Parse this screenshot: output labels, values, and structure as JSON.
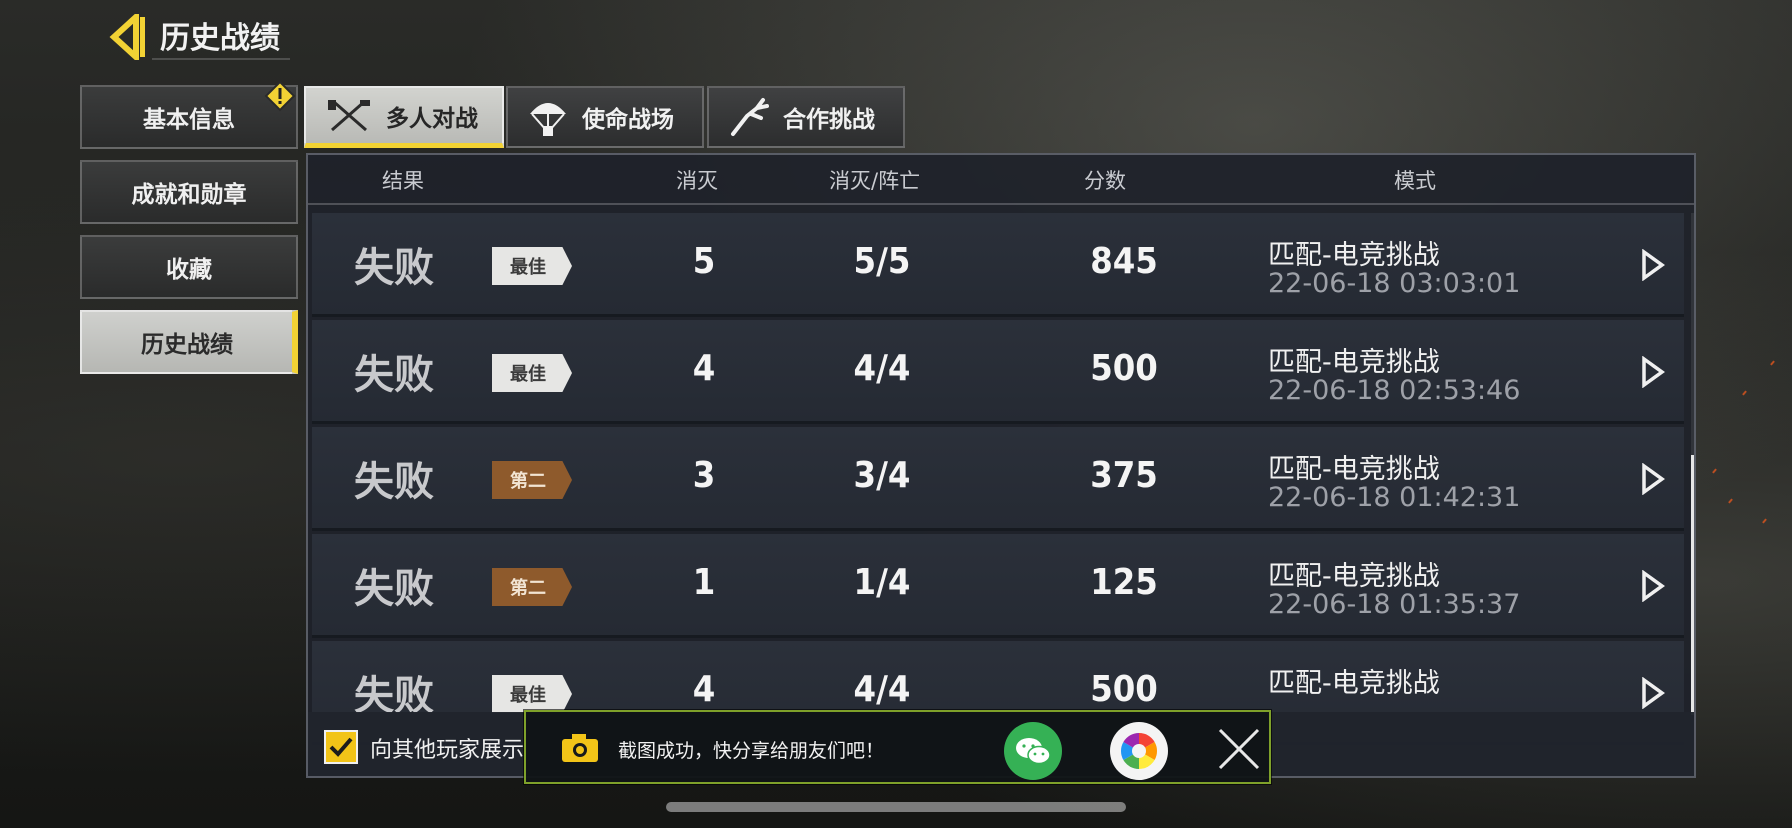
{
  "header": {
    "title": "历史战绩"
  },
  "sidebar": {
    "items": [
      {
        "label": "基本信息"
      },
      {
        "label": "成就和勋章"
      },
      {
        "label": "收藏"
      },
      {
        "label": "历史战绩"
      }
    ]
  },
  "tabs": [
    {
      "label": "多人对战",
      "icon": "multiplayer-crossed-guns-icon"
    },
    {
      "label": "使命战场",
      "icon": "parachute-icon"
    },
    {
      "label": "合作挑战",
      "icon": "zombie-arm-icon"
    }
  ],
  "table": {
    "headers": {
      "result": "结果",
      "kills": "消灭",
      "kd": "消灭/阵亡",
      "score": "分数",
      "mode": "模式"
    },
    "rows": [
      {
        "result": "失败",
        "badge": "最佳",
        "kills": "5",
        "kd": "5/5",
        "score": "845",
        "mode": "匹配-电竞挑战",
        "time": "22-06-18 03:03:01"
      },
      {
        "result": "失败",
        "badge": "最佳",
        "kills": "4",
        "kd": "4/4",
        "score": "500",
        "mode": "匹配-电竞挑战",
        "time": "22-06-18 02:53:46"
      },
      {
        "result": "失败",
        "badge": "第二",
        "kills": "3",
        "kd": "3/4",
        "score": "375",
        "mode": "匹配-电竞挑战",
        "time": "22-06-18 01:42:31"
      },
      {
        "result": "失败",
        "badge": "第二",
        "kills": "1",
        "kd": "1/4",
        "score": "125",
        "mode": "匹配-电竞挑战",
        "time": "22-06-18 01:35:37"
      },
      {
        "result": "失败",
        "badge": "最佳",
        "kills": "4",
        "kd": "4/4",
        "score": "500",
        "mode": "匹配-电竞挑战",
        "time": ""
      }
    ]
  },
  "footer": {
    "checkbox_label": "向其他玩家展示",
    "checked": true
  },
  "toast": {
    "text": "截图成功，快分享给朋友们吧！"
  },
  "colors": {
    "accent": "#f2d234",
    "badge_best": "#e6e6e4",
    "badge_second": "#8e5a2c",
    "wechat": "#35b155"
  }
}
